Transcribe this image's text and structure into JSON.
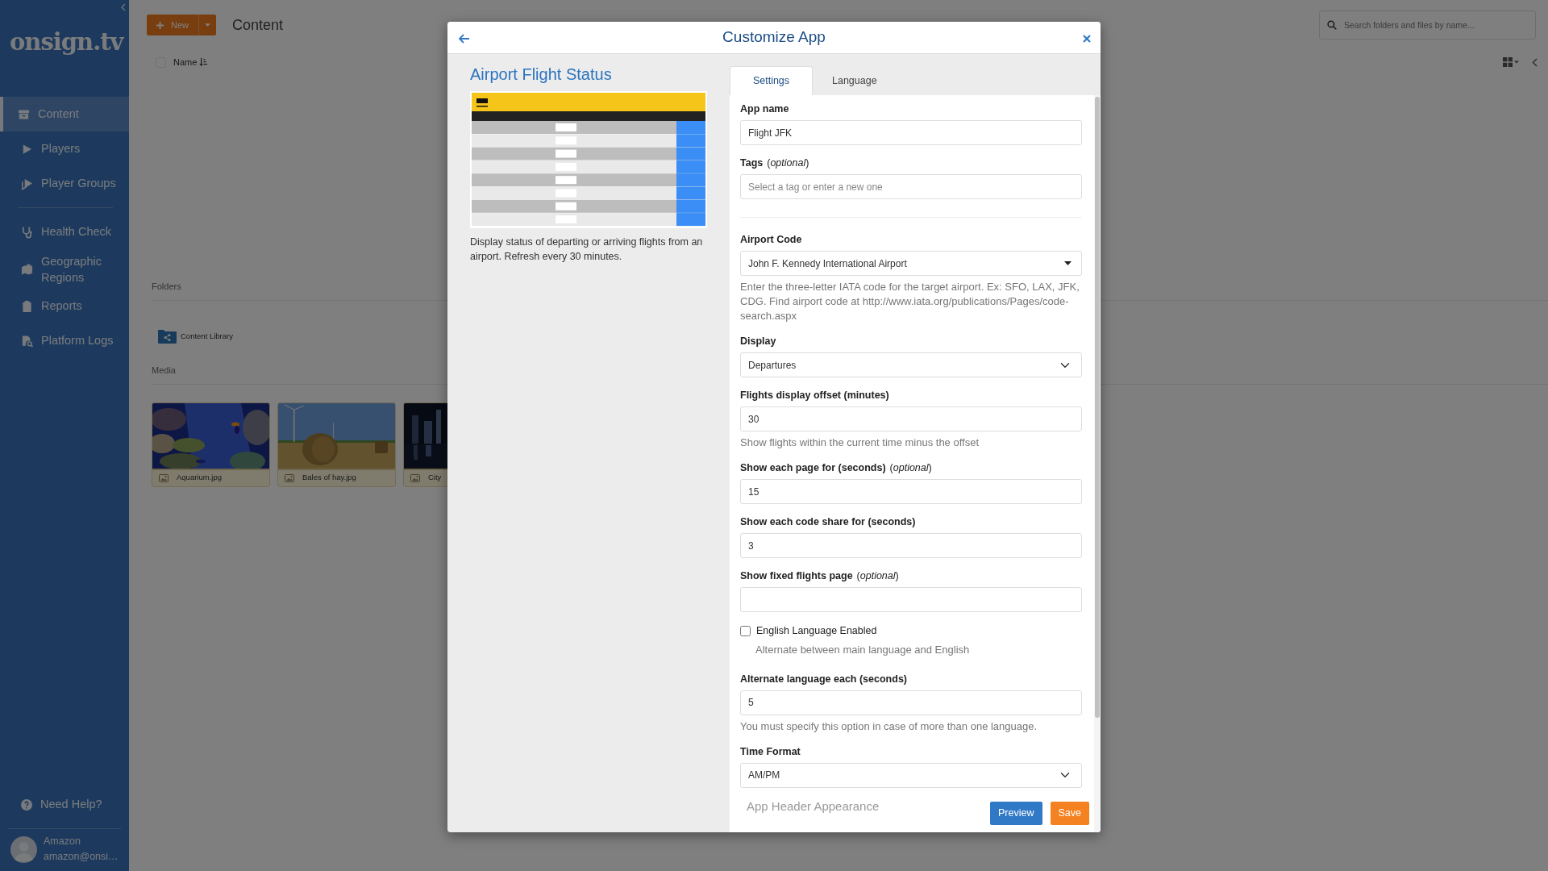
{
  "sidebar": {
    "logo": "onsign.tv",
    "sections": [
      {
        "items": [
          {
            "label": "Content",
            "selected": true
          },
          {
            "label": "Players",
            "selected": false
          },
          {
            "label": "Player Groups",
            "selected": false
          }
        ]
      },
      {
        "items": [
          {
            "label": "Health Check",
            "selected": false
          },
          {
            "label": "Geographic Regions",
            "selected": false
          },
          {
            "label": "Reports",
            "selected": false
          },
          {
            "label": "Platform Logs",
            "selected": false
          }
        ]
      }
    ],
    "help": "Need Help?",
    "user": {
      "name": "Amazon",
      "email": "amazon@onsi…"
    }
  },
  "toolbar": {
    "new_button": "New",
    "title": "Content",
    "search": {
      "placeholder": "Search folders and files by name..."
    }
  },
  "list_header": {
    "column": "Name",
    "checked": false
  },
  "folders": {
    "title": "Folders",
    "items": [
      {
        "name": "Content Library"
      }
    ]
  },
  "media": {
    "title": "Media",
    "items": [
      {
        "name": "Aquarium.jpg"
      },
      {
        "name": "Bales of hay.jpg"
      },
      {
        "name": "City"
      }
    ]
  },
  "modal": {
    "title": "Customize App",
    "app": {
      "title": "Airport Flight Status",
      "description": "Display status of departing or arriving flights from an airport. Refresh every 30 minutes."
    },
    "tabs": [
      {
        "label": "Settings",
        "selected": true
      },
      {
        "label": "Language",
        "selected": false
      }
    ],
    "fields": [
      {
        "kind": "text",
        "label": "App name",
        "value": "Flight JFK"
      },
      {
        "kind": "text",
        "label": "Tags",
        "note": "(*optional*)",
        "placeholder": "Select a tag or enter a new one"
      },
      {
        "kind": "divider"
      },
      {
        "kind": "dropdown",
        "label": "Airport Code",
        "value": "John F. Kennedy International Airport",
        "help": "Enter the three-letter IATA code for the target airport. Ex: SFO, LAX, JFK, CDG. Find airport code at http://www.iata.org/publications/Pages/code-search.aspx"
      },
      {
        "kind": "select",
        "label": "Display",
        "value": "Departures"
      },
      {
        "kind": "text",
        "label": "Flights display offset (minutes)",
        "value": "30",
        "help": "Show flights within the current time minus the offset"
      },
      {
        "kind": "text",
        "label": "Show each page for (seconds)",
        "note": "(*optional*)",
        "value": "15"
      },
      {
        "kind": "text",
        "label": "Show each code share for (seconds)",
        "value": "3"
      },
      {
        "kind": "text",
        "label": "Show fixed flights page",
        "note": "(*optional*)"
      },
      {
        "kind": "checkbox",
        "label": "English Language Enabled",
        "checked": false,
        "help": "Alternate between main language and English"
      },
      {
        "kind": "text",
        "label": "Alternate language each (seconds)",
        "value": "5",
        "help": "You must specify this option in case of more than one language."
      },
      {
        "kind": "select",
        "label": "Time Format",
        "value": "AM/PM"
      }
    ],
    "faded_heading": "App Header Appearance",
    "buttons": [
      {
        "label": "Preview",
        "kind": "primary"
      },
      {
        "label": "Save",
        "kind": "save"
      }
    ]
  }
}
